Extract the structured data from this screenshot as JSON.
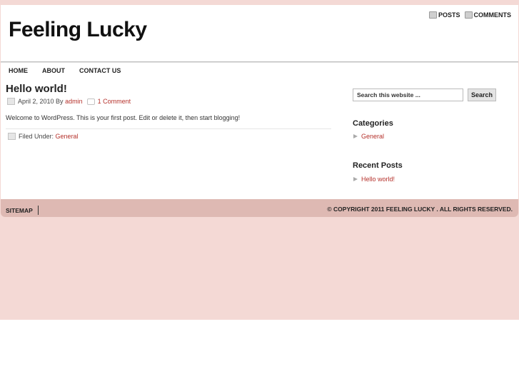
{
  "site": {
    "title": "Feeling Lucky"
  },
  "feeds": [
    {
      "label": "POSTS",
      "icon": "rss-icon"
    },
    {
      "label": "COMMENTS",
      "icon": "rss-icon"
    }
  ],
  "nav": [
    {
      "label": "HOME"
    },
    {
      "label": "ABOUT"
    },
    {
      "label": "CONTACT US"
    }
  ],
  "post": {
    "title": "Hello world!",
    "date_by": "April 2, 2010 By",
    "author": "admin",
    "comments": "1 Comment",
    "body": "Welcome to WordPress. This is your first post. Edit or delete it, then start blogging!",
    "filed_under_label": "Filed Under:",
    "category": "General"
  },
  "sidebar": {
    "search": {
      "value": "Search this website ...",
      "button": "Search"
    },
    "categories": {
      "title": "Categories",
      "items": [
        "General"
      ]
    },
    "recent_posts": {
      "title": "Recent Posts",
      "items": [
        "Hello world!"
      ]
    }
  },
  "footer": {
    "sitemap": "SITEMAP",
    "copyright": "© COPYRIGHT 2011 FEELING LUCKY . ALL RIGHTS RESERVED."
  },
  "colors": {
    "background": "#f4d9d5",
    "footer": "#deb9b3",
    "link": "#b5312b"
  }
}
